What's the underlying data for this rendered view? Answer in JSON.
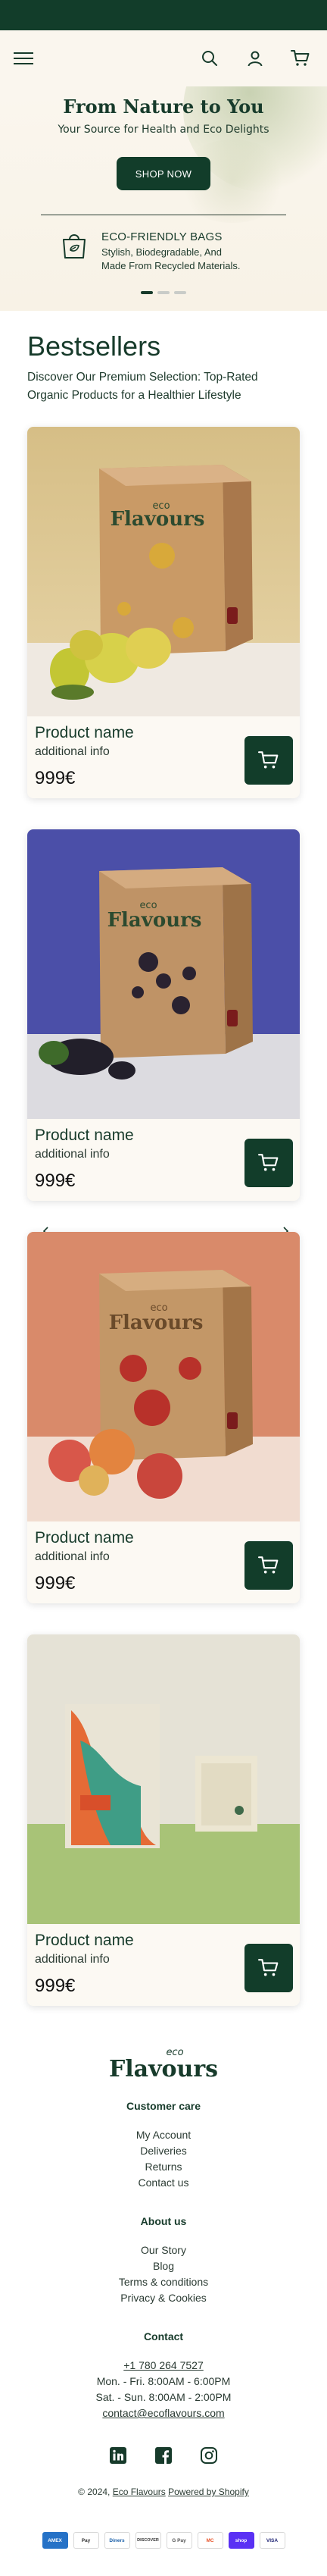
{
  "hero": {
    "title": "From Nature to You",
    "subtitle": "Your Source for Health and Eco Delights",
    "button_label": "SHOP NOW",
    "feature_title": "ECO-FRIENDLY BAGS",
    "feature_desc_line1": "Stylish, Biodegradable, And",
    "feature_desc_line2": "Made From Recycled Materials."
  },
  "bestsellers": {
    "title": "Bestsellers",
    "subtitle_line1": "Discover Our Premium Selection: Top-Rated",
    "subtitle_line2": "Organic Products for a Healthier Lifestyle"
  },
  "products": [
    {
      "name": "Product name",
      "info": "additional info",
      "price": "999€",
      "box_text_top": "eco",
      "box_text_main": "Flavours"
    },
    {
      "name": "Product name",
      "info": "additional info",
      "price": "999€",
      "box_text_top": "eco",
      "box_text_main": "Flavours"
    },
    {
      "name": "Product name",
      "info": "additional info",
      "price": "999€",
      "box_text_top": "eco",
      "box_text_main": "Flavours"
    },
    {
      "name": "Product name",
      "info": "additional info",
      "price": "999€"
    }
  ],
  "footer": {
    "logo_top": "eco",
    "logo_main": "Flavours",
    "customer_care": {
      "heading": "Customer care",
      "links": [
        "My Account",
        "Deliveries",
        "Returns",
        "Contact us"
      ]
    },
    "about": {
      "heading": "About us",
      "links": [
        "Our Story",
        "Blog",
        "Terms & conditions",
        "Privacy & Cookies"
      ]
    },
    "contact": {
      "heading": "Contact",
      "phone": "+1 780 264 7527",
      "hours1": "Mon. - Fri. 8:00AM - 6:00PM",
      "hours2": "Sat. - Sun. 8:00AM - 2:00PM",
      "email": "contact@ecoflavours.com"
    },
    "copyright_prefix": "© 2024, ",
    "copyright_brand": "Eco Flavours",
    "copyright_powered": "Powered by Shopify"
  },
  "payments": [
    "AMEX",
    "Pay",
    "Diners",
    "DISCOVER",
    "G Pay",
    "MC",
    "shop",
    "VISA"
  ],
  "colors": {
    "brand": "#123d2a",
    "background": "#ffffff",
    "hero_bg": "#faf6ee"
  }
}
